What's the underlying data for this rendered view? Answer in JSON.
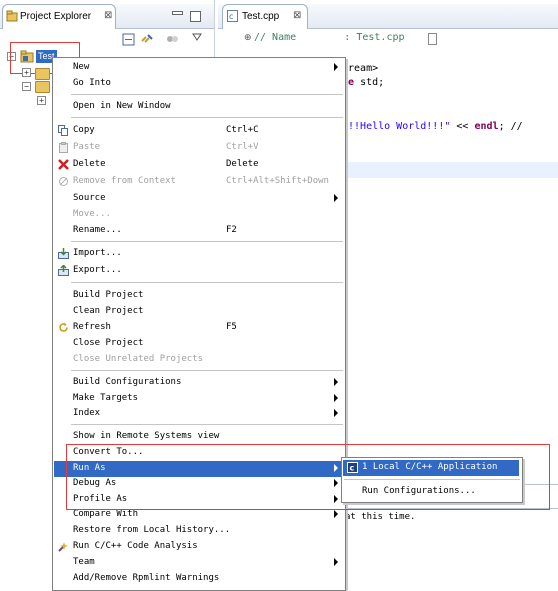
{
  "project_explorer": {
    "tab_title": "Project Explorer",
    "tab_close": "⊠",
    "tree": {
      "selected_item": "Test"
    }
  },
  "editor": {
    "tab_title": "Test.cpp",
    "tab_close": "⊠",
    "code_lines": {
      "l1": "// Name        : Test.cpp",
      "l2": "tream>",
      "l3_kw": "ce",
      "l3_rest": " std;",
      "l4_str": "!!!Hello World!!!\"",
      "l4_rest": " << ",
      "l4_kw": "endl",
      "l4_end": "; //"
    },
    "status_text": "at this time."
  },
  "context_menu": {
    "items": [
      {
        "label": "New",
        "accel": "",
        "submenu": true,
        "disabled": false
      },
      {
        "label": "Go Into",
        "accel": "",
        "submenu": false,
        "disabled": false
      },
      {
        "label": "Open in New Window",
        "accel": "",
        "submenu": false,
        "disabled": false
      },
      {
        "label": "Copy",
        "accel": "Ctrl+C",
        "submenu": false,
        "disabled": false
      },
      {
        "label": "Paste",
        "accel": "Ctrl+V",
        "submenu": false,
        "disabled": true
      },
      {
        "label": "Delete",
        "accel": "Delete",
        "submenu": false,
        "disabled": false
      },
      {
        "label": "Remove from Context",
        "accel": "Ctrl+Alt+Shift+Down",
        "submenu": false,
        "disabled": true
      },
      {
        "label": "Source",
        "accel": "",
        "submenu": true,
        "disabled": false
      },
      {
        "label": "Move...",
        "accel": "",
        "submenu": false,
        "disabled": true
      },
      {
        "label": "Rename...",
        "accel": "F2",
        "submenu": false,
        "disabled": false
      },
      {
        "label": "Import...",
        "accel": "",
        "submenu": false,
        "disabled": false
      },
      {
        "label": "Export...",
        "accel": "",
        "submenu": false,
        "disabled": false
      },
      {
        "label": "Build Project",
        "accel": "",
        "submenu": false,
        "disabled": false
      },
      {
        "label": "Clean Project",
        "accel": "",
        "submenu": false,
        "disabled": false
      },
      {
        "label": "Refresh",
        "accel": "F5",
        "submenu": false,
        "disabled": false
      },
      {
        "label": "Close Project",
        "accel": "",
        "submenu": false,
        "disabled": false
      },
      {
        "label": "Close Unrelated Projects",
        "accel": "",
        "submenu": false,
        "disabled": true
      },
      {
        "label": "Build Configurations",
        "accel": "",
        "submenu": true,
        "disabled": false
      },
      {
        "label": "Make Targets",
        "accel": "",
        "submenu": true,
        "disabled": false
      },
      {
        "label": "Index",
        "accel": "",
        "submenu": true,
        "disabled": false
      },
      {
        "label": "Show in Remote Systems view",
        "accel": "",
        "submenu": false,
        "disabled": false
      },
      {
        "label": "Convert To...",
        "accel": "",
        "submenu": false,
        "disabled": false
      },
      {
        "label": "Run As",
        "accel": "",
        "submenu": true,
        "disabled": false,
        "highlighted": true
      },
      {
        "label": "Debug As",
        "accel": "",
        "submenu": true,
        "disabled": false
      },
      {
        "label": "Profile As",
        "accel": "",
        "submenu": true,
        "disabled": false
      },
      {
        "label": "Compare With",
        "accel": "",
        "submenu": true,
        "disabled": false
      },
      {
        "label": "Restore from Local History...",
        "accel": "",
        "submenu": false,
        "disabled": false
      },
      {
        "label": "Run C/C++ Code Analysis",
        "accel": "",
        "submenu": false,
        "disabled": false
      },
      {
        "label": "Team",
        "accel": "",
        "submenu": true,
        "disabled": false
      },
      {
        "label": "Add/Remove Rpmlint Warnings",
        "accel": "",
        "submenu": false,
        "disabled": false
      }
    ]
  },
  "run_as_submenu": {
    "items": [
      {
        "label": "1 Local C/C++ Application",
        "highlighted": true
      },
      {
        "label": "Run Configurations..."
      }
    ]
  },
  "colors": {
    "selection": "#316ac5",
    "annotation_box": "#e03c3c",
    "disabled_text": "#a0a0a0"
  },
  "icons": {
    "copy": "copy-icon",
    "paste": "paste-icon",
    "delete": "delete-icon",
    "remove_from_context": "remove-context-icon",
    "import": "import-icon",
    "export": "export-icon",
    "refresh": "refresh-icon",
    "code_analysis": "code-analysis-icon",
    "c_app": "c-application-icon"
  }
}
